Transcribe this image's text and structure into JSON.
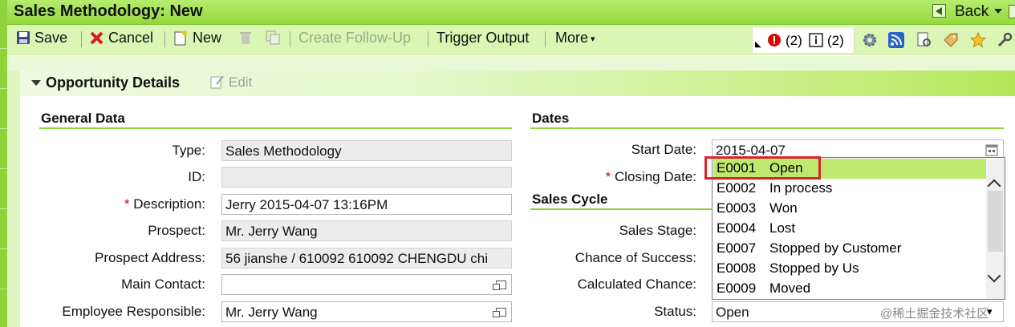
{
  "window": {
    "title": "Sales Methodology: New"
  },
  "nav": {
    "back_label": "Back"
  },
  "toolbar": {
    "save_label": "Save",
    "cancel_label": "Cancel",
    "new_label": "New",
    "create_followup_label": "Create Follow-Up",
    "trigger_output_label": "Trigger Output",
    "more_label": "More",
    "errors_count": "(2)",
    "info_count": "(2)"
  },
  "panel": {
    "title": "Opportunity Details",
    "edit_label": "Edit"
  },
  "general_data": {
    "title": "General Data",
    "type_label": "Type:",
    "type_value": "Sales Methodology",
    "id_label": "ID:",
    "id_value": "",
    "description_label": "Description:",
    "description_value": "Jerry 2015-04-07 13:16PM",
    "prospect_label": "Prospect:",
    "prospect_value": "Mr. Jerry Wang",
    "prospect_address_label": "Prospect Address:",
    "prospect_address_value": "56 jianshe / 610092 610092 CHENGDU chi",
    "main_contact_label": "Main Contact:",
    "main_contact_value": "",
    "employee_label": "Employee Responsible:",
    "employee_value": "Mr. Jerry Wang"
  },
  "dates": {
    "title": "Dates",
    "start_label": "Start Date:",
    "start_value": "2015-04-07",
    "closing_label": "Closing Date:"
  },
  "sales_cycle": {
    "title": "Sales Cycle",
    "stage_label": "Sales Stage:",
    "chance_label": "Chance of Success:",
    "calc_label": "Calculated Chance:",
    "status_label": "Status:",
    "status_value": "Open"
  },
  "status_dropdown": {
    "options": [
      {
        "code": "E0001",
        "text": "Open"
      },
      {
        "code": "E0002",
        "text": "In process"
      },
      {
        "code": "E0003",
        "text": "Won"
      },
      {
        "code": "E0004",
        "text": "Lost"
      },
      {
        "code": "E0007",
        "text": "Stopped by Customer"
      },
      {
        "code": "E0008",
        "text": "Stopped by Us"
      },
      {
        "code": "E0009",
        "text": "Moved"
      }
    ],
    "selected_index": 0,
    "highlight_color": "#bde96e"
  },
  "colors": {
    "accent_green": "#8fd23a",
    "title_bar": "#a6e25a",
    "toolbar": "#dbf6b4",
    "required": "#d40000",
    "callout": "#d9242c"
  },
  "watermark": "@稀土掘金技术社区"
}
